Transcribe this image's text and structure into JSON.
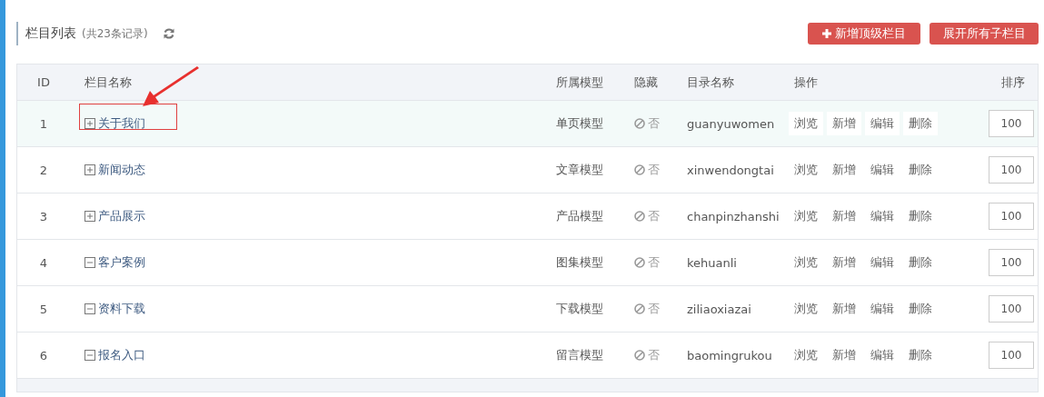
{
  "header": {
    "title": "栏目列表",
    "count": "(共23条记录)",
    "buttons": [
      {
        "label": "新增顶级栏目",
        "kind": "add"
      },
      {
        "label": "展开所有子栏目",
        "kind": "plain"
      }
    ]
  },
  "table": {
    "columns": [
      "ID",
      "栏目名称",
      "所属模型",
      "隐藏",
      "目录名称",
      "操作",
      "排序"
    ],
    "rows": [
      {
        "id": "1",
        "name": "关于我们",
        "expanded": false,
        "hovered": true,
        "marked": true,
        "model": "单页模型",
        "hidden": "否",
        "dir": "guanyuwomen",
        "actions": [
          "浏览",
          "新增",
          "编辑",
          "删除"
        ],
        "sort": "100"
      },
      {
        "id": "2",
        "name": "新闻动态",
        "expanded": false,
        "hovered": false,
        "marked": false,
        "model": "文章模型",
        "hidden": "否",
        "dir": "xinwendongtai",
        "actions": [
          "浏览",
          "新增",
          "编辑",
          "删除"
        ],
        "sort": "100"
      },
      {
        "id": "3",
        "name": "产品展示",
        "expanded": false,
        "hovered": false,
        "marked": false,
        "model": "产品模型",
        "hidden": "否",
        "dir": "chanpinzhanshi",
        "actions": [
          "浏览",
          "新增",
          "编辑",
          "删除"
        ],
        "sort": "100"
      },
      {
        "id": "4",
        "name": "客户案例",
        "expanded": true,
        "hovered": false,
        "marked": false,
        "model": "图集模型",
        "hidden": "否",
        "dir": "kehuanli",
        "actions": [
          "浏览",
          "新增",
          "编辑",
          "删除"
        ],
        "sort": "100"
      },
      {
        "id": "5",
        "name": "资料下载",
        "expanded": true,
        "hovered": false,
        "marked": false,
        "model": "下载模型",
        "hidden": "否",
        "dir": "ziliaoxiazai",
        "actions": [
          "浏览",
          "新增",
          "编辑",
          "删除"
        ],
        "sort": "100"
      },
      {
        "id": "6",
        "name": "报名入口",
        "expanded": true,
        "hovered": false,
        "marked": false,
        "model": "留言模型",
        "hidden": "否",
        "dir": "baomingrukou",
        "actions": [
          "浏览",
          "新增",
          "编辑",
          "删除"
        ],
        "sort": "100"
      }
    ]
  }
}
